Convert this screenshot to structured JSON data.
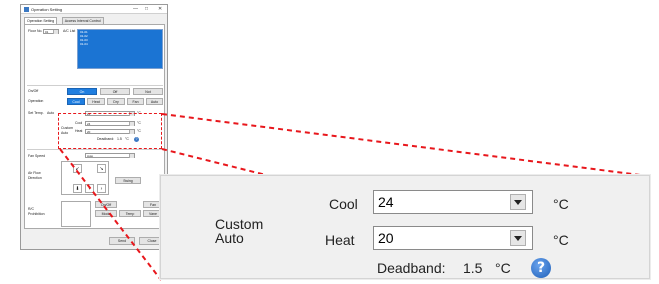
{
  "dialog": {
    "title": "Operation Setting",
    "win_controls": {
      "minimize": "—",
      "maximize": "□",
      "close": "✕"
    },
    "tabs": [
      {
        "label": "Operation Setting"
      },
      {
        "label": "Access Interval Control"
      }
    ],
    "floor_label": "Floor No.",
    "floor_value": "01",
    "ac_list_label": "A/C List",
    "ac_list_items": [
      "01-01",
      "01-02",
      "01-03",
      "01-04"
    ],
    "on_off_label": "On/Off",
    "on_off_buttons": [
      "On",
      "Off",
      "Not"
    ],
    "operation_label": "Operation",
    "operation_buttons": [
      "Cool",
      "Heat",
      "Dry",
      "Fan",
      "Auto"
    ],
    "set_temp_label": "Set Temp.",
    "set_temp_mode": "Auto",
    "set_temp_value": "24",
    "set_temp_unit": "°C",
    "custom_auto_label_line1": "Custom",
    "custom_auto_label_line2": "Auto",
    "cool_label": "Cool",
    "cool_value": "24",
    "heat_label": "Heat",
    "heat_value": "20",
    "deadband_label": "Deadband:",
    "deadband_value": "1.5",
    "unit": "°C",
    "help_glyph": "?",
    "fan_speed_label": "Fan Speed",
    "fan_speed_value": "Auto",
    "airflow_label_line1": "Air Flow",
    "airflow_label_line2": "Direction",
    "swing_label": "Swing",
    "vent_label_line1": "R/C",
    "vent_label_line2": "Prohibition",
    "vent_buttons": [
      "On/Off",
      "Mode",
      "Temp",
      "Fan",
      "Vane"
    ],
    "footer_buttons": [
      "Send",
      "Close"
    ]
  },
  "zoom": {
    "custom_line1": "Custom",
    "custom_line2": "Auto",
    "cool_label": "Cool",
    "cool_value": "24",
    "heat_label": "Heat",
    "heat_value": "20",
    "unit": "°C",
    "deadband_label": "Deadband:",
    "deadband_value": "1.5",
    "help_glyph": "?"
  },
  "colors": {
    "highlight": "#e8171c",
    "selection": "#1b74d3",
    "help": "#3b78c4"
  }
}
